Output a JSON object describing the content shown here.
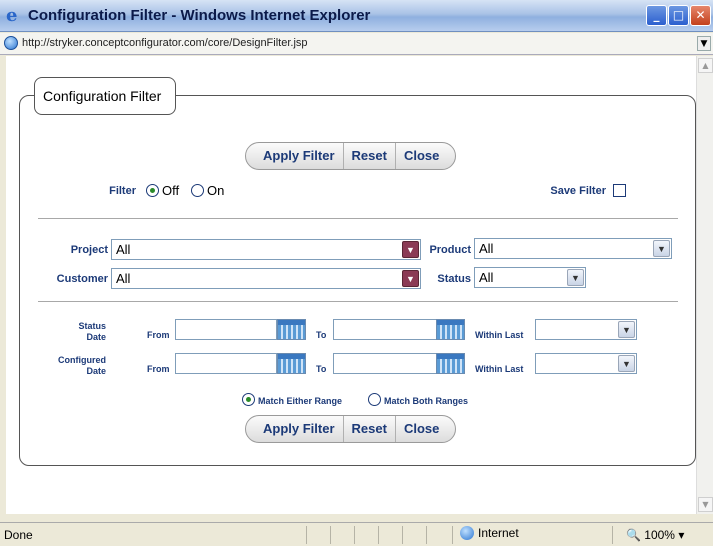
{
  "window": {
    "title": "Configuration Filter - Windows Internet Explorer",
    "icon": "ie-icon"
  },
  "address": {
    "url": "http://stryker.conceptconfigurator.com/core/DesignFilter.jsp"
  },
  "panel": {
    "legend": "Configuration Filter"
  },
  "buttons": {
    "apply": "Apply Filter",
    "reset": "Reset",
    "close": "Close"
  },
  "filter": {
    "label": "Filter",
    "off": "Off",
    "on": "On",
    "selected": "off",
    "save_label": "Save Filter",
    "save_checked": false
  },
  "fields": {
    "project_label": "Project",
    "project_value": "All",
    "product_label": "Product",
    "product_value": "All",
    "customer_label": "Customer",
    "customer_value": "All",
    "status_label": "Status",
    "status_value": "All"
  },
  "dates": {
    "status_label_1": "Status",
    "status_label_2": "Date",
    "configured_label_1": "Configured",
    "configured_label_2": "Date",
    "from": "From",
    "to": "To",
    "within_last": "Within Last",
    "status_from": "",
    "status_to": "",
    "status_within": "",
    "configured_from": "",
    "configured_to": "",
    "configured_within": ""
  },
  "match": {
    "either": "Match Either Range",
    "both": "Match Both Ranges",
    "selected": "either"
  },
  "statusbar": {
    "text": "Done",
    "zone": "Internet",
    "zoom": "100%"
  }
}
